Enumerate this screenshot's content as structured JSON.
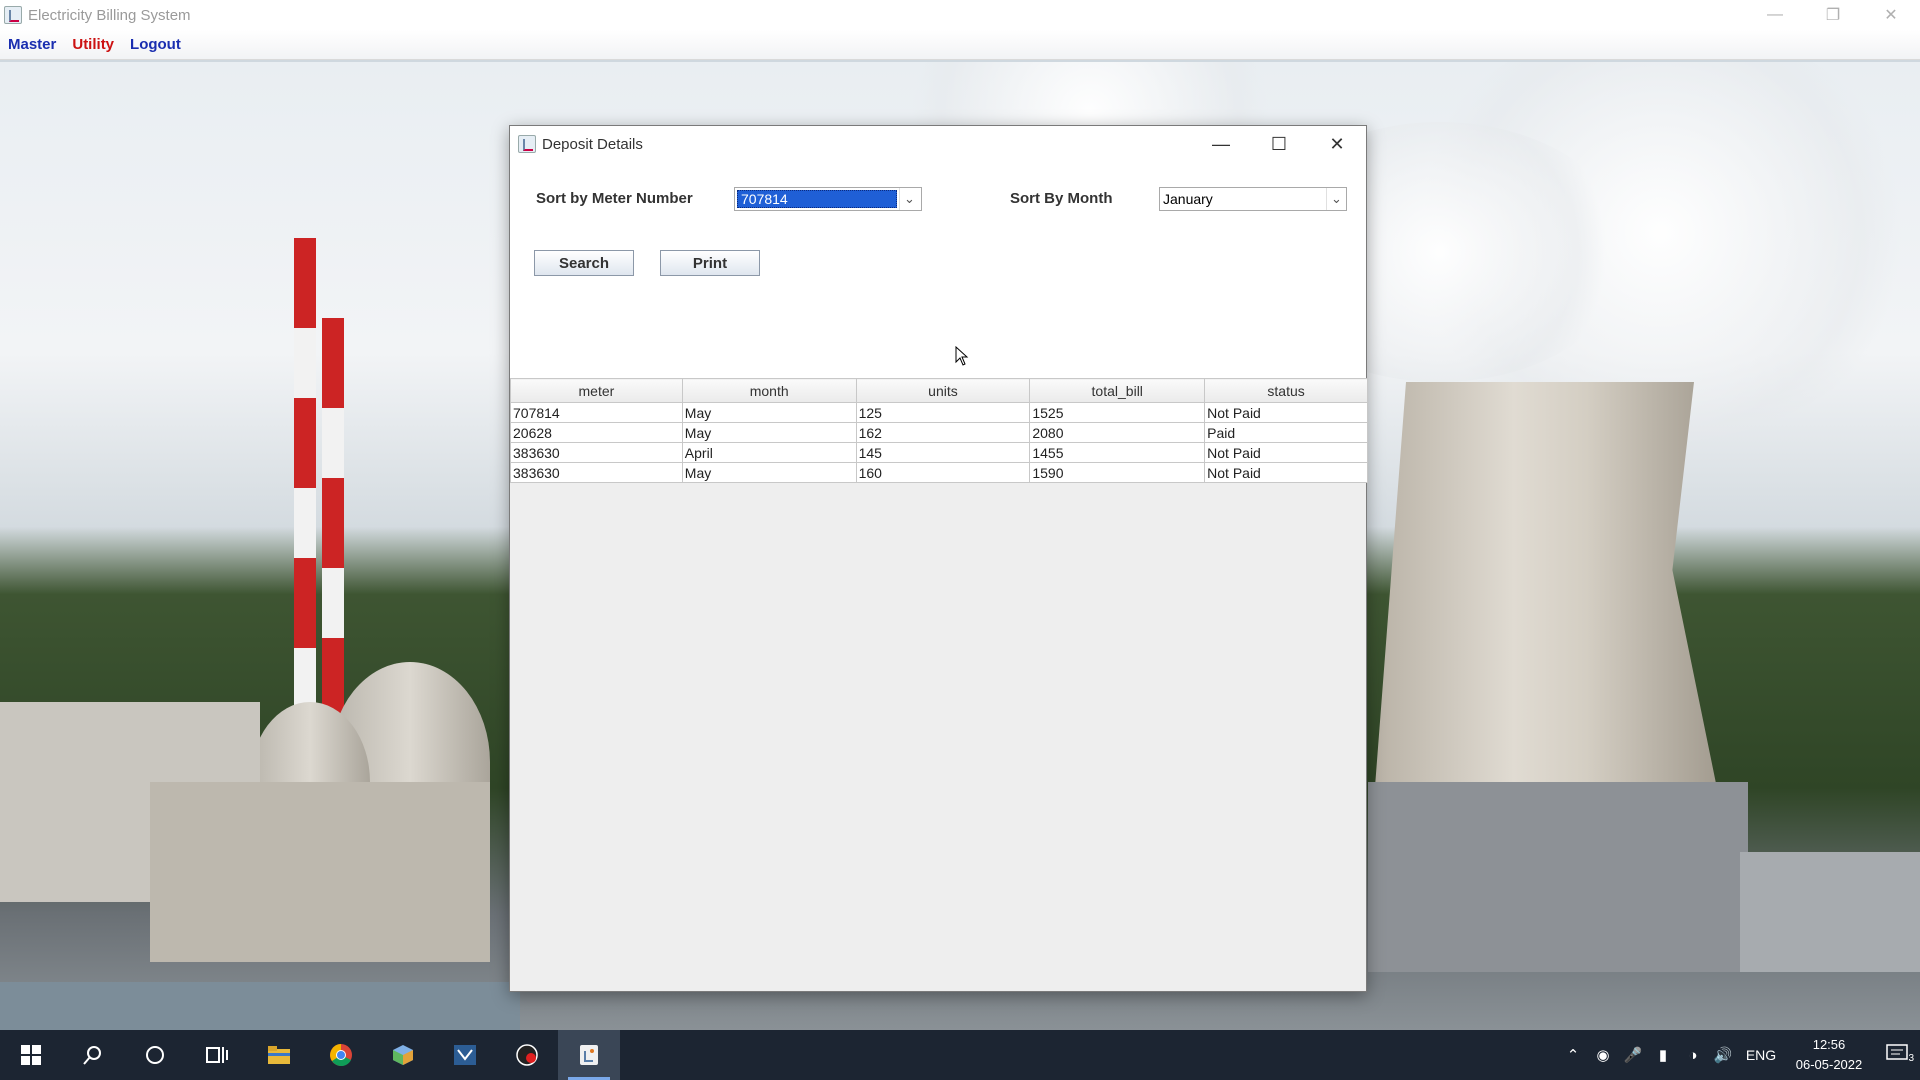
{
  "app": {
    "title": "Electricity Billing System",
    "menu": [
      {
        "label": "Master",
        "color": "#1a2eb0"
      },
      {
        "label": "Utility",
        "color": "#cc1111"
      },
      {
        "label": "Logout",
        "color": "#1a2eb0"
      }
    ]
  },
  "dialog": {
    "title": "Deposit Details",
    "meter_label": "Sort by Meter Number",
    "meter_value": "707814",
    "month_label": "Sort By Month",
    "month_value": "January",
    "search_label": "Search",
    "print_label": "Print"
  },
  "table": {
    "columns": [
      "meter",
      "month",
      "units",
      "total_bill",
      "status"
    ],
    "rows": [
      [
        "707814",
        "May",
        "125",
        "1525",
        "Not Paid"
      ],
      [
        "20628",
        "May",
        "162",
        "2080",
        "Paid"
      ],
      [
        "383630",
        "April",
        "145",
        "1455",
        "Not Paid"
      ],
      [
        "383630",
        "May",
        "160",
        "1590",
        "Not Paid"
      ]
    ]
  },
  "taskbar": {
    "icons": [
      "windows-start-icon",
      "search-icon",
      "cortana-icon",
      "task-view-icon",
      "file-explorer-icon",
      "chrome-icon",
      "app-cube-icon",
      "visual-studio-icon",
      "media-app-icon",
      "java-app-icon"
    ],
    "language": "ENG",
    "time": "12:56",
    "date": "06-05-2022",
    "notifications": "3"
  }
}
